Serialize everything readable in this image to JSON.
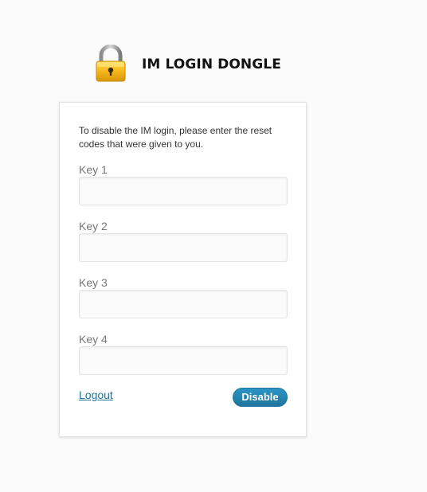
{
  "header": {
    "icon": "padlock-icon",
    "title": "IM LOGIN DONGLE"
  },
  "form": {
    "intro": "To disable the IM login, please enter the reset codes that were given to you.",
    "fields": [
      {
        "label": "Key 1",
        "value": ""
      },
      {
        "label": "Key 2",
        "value": ""
      },
      {
        "label": "Key 3",
        "value": ""
      },
      {
        "label": "Key 4",
        "value": ""
      }
    ],
    "logout_label": "Logout",
    "submit_label": "Disable"
  },
  "colors": {
    "background": "#fbfbfb",
    "link": "#21759b",
    "button": "#21759b",
    "lock_body": "#f2b51c",
    "lock_shackle": "#a0a0a0"
  }
}
